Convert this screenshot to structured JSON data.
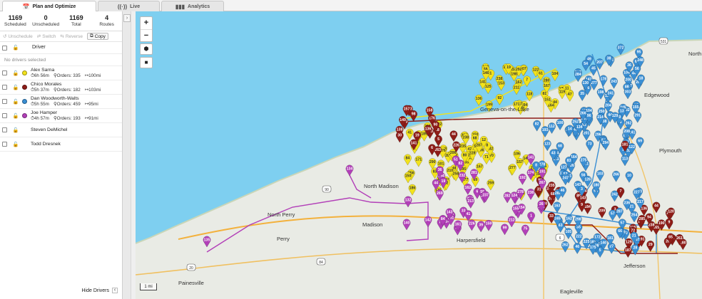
{
  "tabs": [
    {
      "label": "Plan and Optimize",
      "icon": "calendar-icon"
    },
    {
      "label": "Live",
      "icon": "broadcast-icon"
    },
    {
      "label": "Analytics",
      "icon": "bar-chart-icon"
    }
  ],
  "stats": [
    {
      "value": "1169",
      "label": "Scheduled"
    },
    {
      "value": "0",
      "label": "Unscheduled"
    },
    {
      "value": "1169",
      "label": "Total"
    },
    {
      "value": "4",
      "label": "Routes"
    }
  ],
  "actions": {
    "unschedule": "Unschedule",
    "switch": "Switch",
    "reverse": "Reverse",
    "copy": "Copy"
  },
  "header": {
    "driver_col": "Driver"
  },
  "no_drivers_text": "No drivers selected",
  "drivers": [
    {
      "name": "Alex Sarna",
      "color": "#f2e21c",
      "time": "6h 56m",
      "orders": "Orders: 335",
      "distance": "100mi"
    },
    {
      "name": "Chico Morales",
      "color": "#8e1d18",
      "time": "5h 37m",
      "orders": "Orders: 182",
      "distance": "103mi"
    },
    {
      "name": "Dan Woodworth-Walts",
      "color": "#3a8fd4",
      "time": "5h 55m",
      "orders": "Orders: 459",
      "distance": "95mi"
    },
    {
      "name": "Joe Hamper",
      "color": "#b23fb8",
      "time": "4h 57m",
      "orders": "Orders: 193",
      "distance": "91mi"
    },
    {
      "name": "Steven DeMichel"
    },
    {
      "name": "Todd Dresnek"
    }
  ],
  "hide_drivers": "Hide Drivers",
  "map": {
    "zoom_in": "+",
    "zoom_out": "−",
    "scale": "1 mi",
    "places": [
      "Geneva-on-the-Lake",
      "North Madison",
      "North Perry",
      "Madison",
      "Perry",
      "Harpersfield",
      "Painesville",
      "Jefferson",
      "Plymouth",
      "Edgewood",
      "North Kingsville",
      "Eagleville"
    ],
    "road_shields": [
      "531",
      "90",
      "20",
      "84",
      "6"
    ],
    "highlighted_stops": [
      "134",
      "135",
      "157",
      "158",
      "136",
      "141",
      "150",
      "132",
      "140",
      "142",
      "143",
      "161",
      "372",
      "303",
      "181",
      "113",
      "65",
      "94",
      "44"
    ],
    "colors": {
      "lake": "#7ecff0",
      "land": "#e9ebe5",
      "yellow": "#f2e21c",
      "red": "#8e1d18",
      "blue": "#3a8fd4",
      "purple": "#b23fb8"
    }
  }
}
